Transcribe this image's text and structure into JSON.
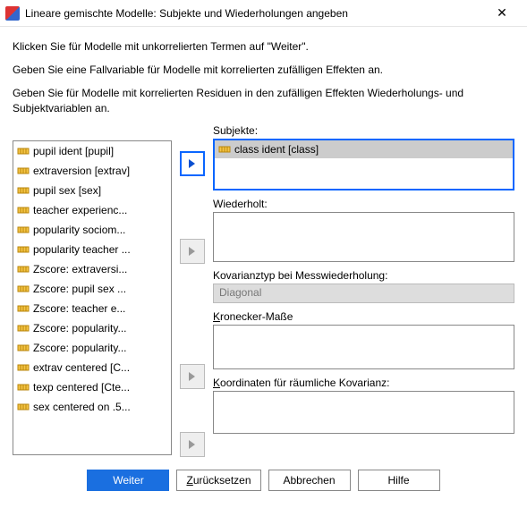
{
  "window": {
    "title": "Lineare gemischte Modelle: Subjekte und Wiederholungen angeben"
  },
  "intro": {
    "p1": "Klicken Sie für Modelle mit unkorrelierten Termen auf \"Weiter\".",
    "p2": "Geben Sie eine Fallvariable für Modelle mit korrelierten zufälligen Effekten an.",
    "p3": "Geben Sie für Modelle mit korrelierten Residuen in den zufälligen Effekten Wiederholungs- und Subjektvariablen an."
  },
  "source_vars": [
    "pupil ident [pupil]",
    "extraversion [extrav]",
    "pupil sex [sex]",
    "teacher experienc...",
    "popularity sociom...",
    "popularity teacher ...",
    "Zscore:  extraversi...",
    "Zscore:  pupil sex ...",
    "Zscore:  teacher e...",
    "Zscore:  popularity...",
    "Zscore:  popularity...",
    "extrav centered [C...",
    "texp centered [Cte...",
    "sex centered on .5..."
  ],
  "labels": {
    "subjekte": "Subjekte:",
    "wiederholt": "Wiederholt:",
    "kovtyp": "Kovarianztyp bei Messwiederholung:",
    "kronecker_u": "K",
    "kronecker_rest": "ronecker-Maße",
    "koord_u": "K",
    "koord_rest": "oordinaten für räumliche Kovarianz:"
  },
  "subjekte_items": [
    "class ident [class]"
  ],
  "kov_value": "Diagonal",
  "buttons": {
    "weiter": "Weiter",
    "zuruck_u": "Z",
    "zuruck_rest": "urücksetzen",
    "abbrechen": "Abbrechen",
    "hilfe": "Hilfe"
  }
}
